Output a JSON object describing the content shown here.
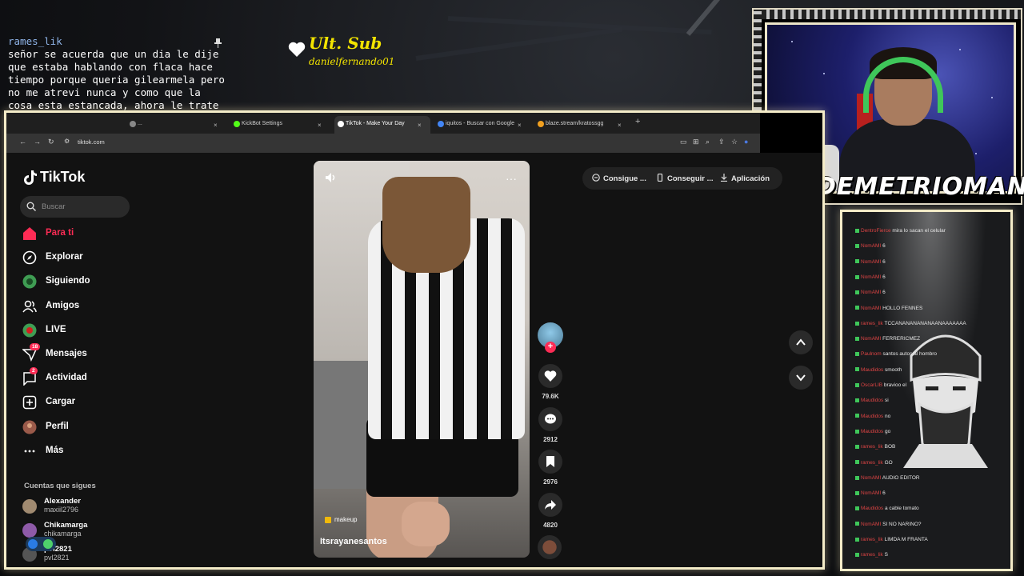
{
  "overlay": {
    "chat_top": {
      "user": "rames_lik",
      "message": "señor se acuerda que un dia le dije que estaba hablando con flaca hace tiempo porque queria gilearmela pero no me atrevi nunca y como que la cosa esta estancada, ahora le trate de hablar con mas intencion pero aun no"
    },
    "last_sub": {
      "title": "Ult. Sub",
      "name": "danielfernando01"
    },
    "streamer_name": "DEMETRIOMAN",
    "chat_lines": [
      {
        "who": "DentroFierce",
        "text": "mira lo sacan el celular"
      },
      {
        "who": "NomAMI",
        "text": "6"
      },
      {
        "who": "NomAMI",
        "text": "6"
      },
      {
        "who": "NomAMI",
        "text": "6"
      },
      {
        "who": "NomAMI",
        "text": "6"
      },
      {
        "who": "NomAMI",
        "text": "HOLLO FENNES"
      },
      {
        "who": "rames_lik",
        "text": "TCCANANANANANAANAAAAAAA"
      },
      {
        "who": "NomAMI",
        "text": "FERRERICMEZ"
      },
      {
        "who": "Paulnom",
        "text": "santos autos al hombro"
      },
      {
        "who": "Maudidos",
        "text": "smooth"
      },
      {
        "who": "OscarLIB",
        "text": "bravioo el"
      },
      {
        "who": "Maudidos",
        "text": "si"
      },
      {
        "who": "Maudidos",
        "text": "no"
      },
      {
        "who": "Maudidos",
        "text": "go"
      },
      {
        "who": "rames_lik",
        "text": "BOB"
      },
      {
        "who": "rames_lik",
        "text": "GO"
      },
      {
        "who": "NomAMI",
        "text": "AUDIO EDITOR"
      },
      {
        "who": "NomAMI",
        "text": "6"
      },
      {
        "who": "Maudidos",
        "text": "a cable tomato"
      },
      {
        "who": "NomAMI",
        "text": "SI NO NARINO?"
      },
      {
        "who": "rames_lik",
        "text": "LIMDA M FRANTA"
      },
      {
        "who": "rames_lik",
        "text": "S"
      }
    ]
  },
  "browser": {
    "tabs": [
      {
        "label": "...",
        "active": false,
        "fav": "#888888"
      },
      {
        "label": "KickBot Settings",
        "active": false,
        "fav": "#53fc18"
      },
      {
        "label": "TikTok - Make Your Day",
        "active": true,
        "fav": "#ffffff"
      },
      {
        "label": "iquitos - Buscar con Google",
        "active": false,
        "fav": "#4285f4"
      },
      {
        "label": "blaze.stream/kratossgg",
        "active": false,
        "fav": "#f0a020"
      }
    ],
    "url": "tiktok.com"
  },
  "tiktok": {
    "logo": "TikTok",
    "search_placeholder": "Buscar",
    "nav": [
      {
        "label": "Para ti",
        "icon": "home-icon",
        "active": true
      },
      {
        "label": "Explorar",
        "icon": "compass-icon",
        "active": false
      },
      {
        "label": "Siguiendo",
        "icon": "following-avatar-icon",
        "active": false
      },
      {
        "label": "Amigos",
        "icon": "friends-icon",
        "active": false
      },
      {
        "label": "LIVE",
        "icon": "live-icon",
        "active": false
      },
      {
        "label": "Mensajes",
        "icon": "messages-icon",
        "active": false,
        "badge": "18"
      },
      {
        "label": "Actividad",
        "icon": "activity-icon",
        "active": false,
        "badge": "2"
      },
      {
        "label": "Cargar",
        "icon": "upload-icon",
        "active": false
      },
      {
        "label": "Perfil",
        "icon": "profile-avatar-icon",
        "active": false
      },
      {
        "label": "Más",
        "icon": "more-icon",
        "active": false
      }
    ],
    "following_title": "Cuentas que sigues",
    "following": [
      {
        "name": "Alexander",
        "handle": "maxiil2796",
        "color": "#a08a70"
      },
      {
        "name": "Chikamarga",
        "handle": "chikamarga",
        "color": "#8e5aa8"
      },
      {
        "name": "pvl2821",
        "handle": "pvl2821",
        "color": "#555555"
      }
    ],
    "video": {
      "tag": "makeup",
      "author": "Itsrayanesantos"
    },
    "actions": {
      "likes": "79.6K",
      "comments": "2912",
      "saves": "2976",
      "shares": "4820"
    },
    "top_actions": [
      {
        "label": "Consigue ...",
        "icon": "coin-icon"
      },
      {
        "label": "Conseguir ...",
        "icon": "phone-icon"
      },
      {
        "label": "Aplicación",
        "icon": "download-icon"
      }
    ]
  },
  "colors": {
    "tiktok_accent": "#fe2c55",
    "sub_yellow": "#f3e400",
    "frame_cream": "#f4ecc8"
  }
}
